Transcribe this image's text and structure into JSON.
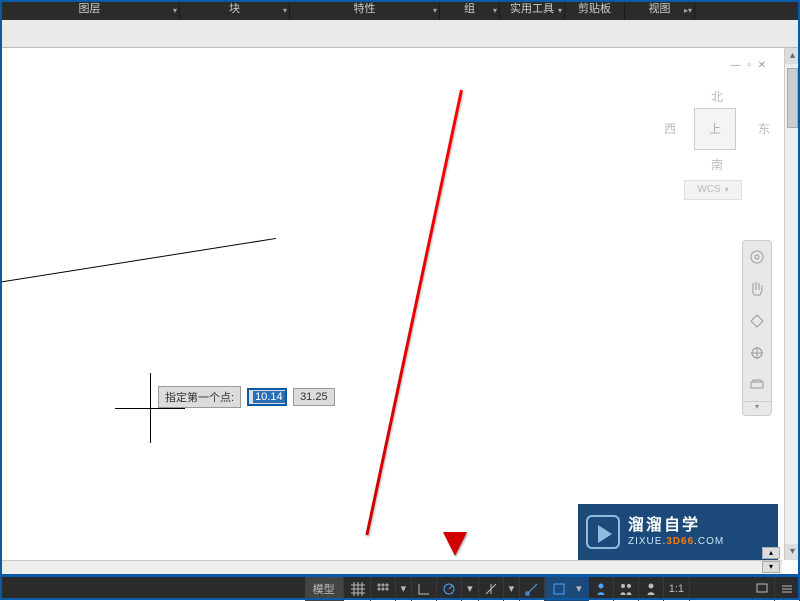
{
  "ribbon": {
    "layers": "图层",
    "block": "块",
    "properties": "特性",
    "group": "组",
    "utilities": "实用工具",
    "clipboard": "剪贴板",
    "view": "视图"
  },
  "viewcube": {
    "north": "北",
    "west": "西",
    "east": "东",
    "south": "南",
    "top": "上",
    "wcs": "WCS",
    "controls": "— ▫ ✕"
  },
  "dynamic_input": {
    "prompt": "指定第一个点:",
    "x": "10.14",
    "y": "31.25"
  },
  "statusbar": {
    "model": "模型",
    "scale": "1:1"
  },
  "watermark": {
    "title": "溜溜自学",
    "sub_prefix": "ZIXUE.",
    "sub_domain": "3D66",
    "sub_suffix": ".COM"
  }
}
